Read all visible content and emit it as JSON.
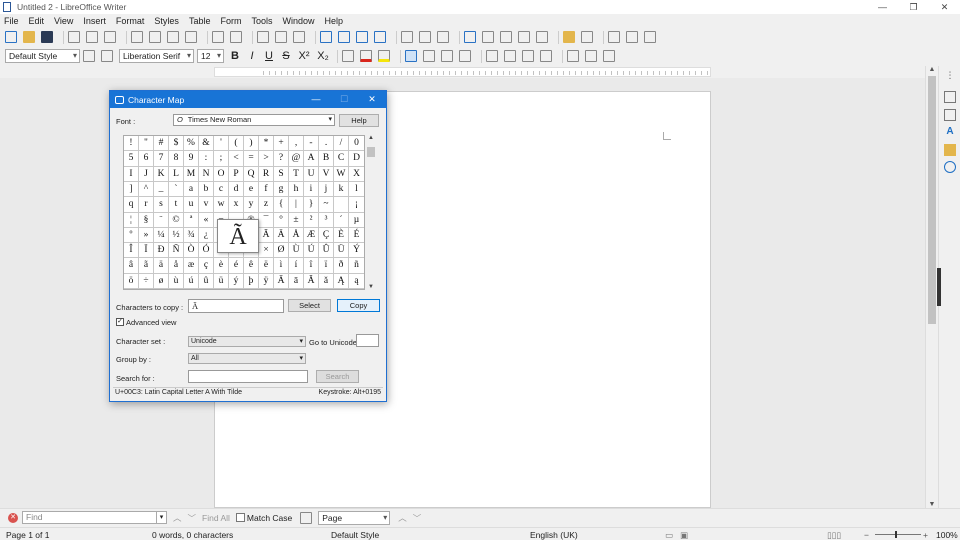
{
  "window": {
    "title": "Untitled 2 - LibreOffice Writer",
    "controls": [
      "—",
      "❐",
      "✕"
    ]
  },
  "menu": [
    "File",
    "Edit",
    "View",
    "Insert",
    "Format",
    "Styles",
    "Table",
    "Form",
    "Tools",
    "Window",
    "Help"
  ],
  "formatting": {
    "paragraph_style": "Default Style",
    "font_name": "Liberation Serif",
    "font_size": "12",
    "bold": "B",
    "italic": "I",
    "underline": "U",
    "strike": "S",
    "superscript": "X²",
    "subscript": "X₂"
  },
  "dialog": {
    "title": "Character Map",
    "font_label": "Font :",
    "font_value": "Times New Roman",
    "help_button": "Help",
    "characters_label": [
      [
        "!",
        "\"",
        "#",
        "$",
        "%",
        "&",
        "'",
        "(",
        ")",
        "*",
        "+",
        ",",
        "-",
        ".",
        "/",
        "0",
        "1",
        "2",
        "3",
        "4"
      ],
      [
        "5",
        "6",
        "7",
        "8",
        "9",
        ":",
        ";",
        "<",
        "=",
        ">",
        "?",
        "@",
        "A",
        "B",
        "C",
        "D",
        "E",
        "F",
        "G",
        "H"
      ],
      [
        "I",
        "J",
        "K",
        "L",
        "M",
        "N",
        "O",
        "P",
        "Q",
        "R",
        "S",
        "T",
        "U",
        "V",
        "W",
        "X",
        "Y",
        "Z",
        "[",
        "\\"
      ],
      [
        "]",
        "^",
        "_",
        "`",
        "a",
        "b",
        "c",
        "d",
        "e",
        "f",
        "g",
        "h",
        "i",
        "j",
        "k",
        "l",
        "m",
        "n",
        "o",
        "p"
      ],
      [
        "q",
        "r",
        "s",
        "t",
        "u",
        "v",
        "w",
        "x",
        "y",
        "z",
        "{",
        "|",
        "}",
        "~",
        "",
        "¡",
        "¢",
        "£",
        "¤",
        "¥"
      ],
      [
        "¦",
        "§",
        "¨",
        "©",
        "ª",
        "«",
        "¬",
        "",
        "®",
        "¯",
        "°",
        "±",
        "²",
        "³",
        "´",
        "µ",
        "¶",
        "·",
        "¸",
        "¹"
      ],
      [
        "º",
        "»",
        "¼",
        "½",
        "¾",
        "¿",
        "À",
        "Á",
        "Â",
        "Ã",
        "Ä",
        "Å",
        "Æ",
        "Ç",
        "È",
        "É",
        "Ê",
        "Ë",
        "Ì",
        "Í"
      ],
      [
        "Î",
        "Ï",
        "Ð",
        "Ñ",
        "Ò",
        "Ó",
        "Ô",
        "Õ",
        "Ö",
        "×",
        "Ø",
        "Ù",
        "Ú",
        "Û",
        "Ü",
        "Ý",
        "Þ",
        "ß",
        "à",
        "á"
      ],
      [
        "â",
        "ã",
        "ä",
        "å",
        "æ",
        "ç",
        "è",
        "é",
        "ê",
        "ë",
        "ì",
        "í",
        "î",
        "ï",
        "ð",
        "ñ",
        "ò",
        "ó",
        "ô",
        "õ"
      ],
      [
        "ö",
        "÷",
        "ø",
        "ù",
        "ú",
        "û",
        "ü",
        "ý",
        "þ",
        "ÿ",
        "Ā",
        "ā",
        "Ă",
        "ă",
        "Ą",
        "ą",
        "Ć",
        "ć",
        "Ĉ",
        "ĉ"
      ]
    ],
    "grid_rows": [
      [
        "!",
        "\"",
        "#",
        "$",
        "%",
        "&",
        "'",
        "(",
        ")",
        "*",
        "+",
        ",",
        "-",
        ".",
        "/",
        "0",
        "1",
        "2",
        "3",
        "4"
      ],
      [
        "5",
        "6",
        "7",
        "8",
        "9",
        ":",
        ";",
        "<",
        "=",
        ">",
        "?",
        "@",
        "A",
        "B",
        "C",
        "D",
        "E",
        "F",
        "G",
        "H"
      ]
    ],
    "grid": [
      "!",
      "\"",
      "#",
      "$",
      "%",
      "&",
      "'",
      "(",
      ")",
      "*",
      "+",
      ",",
      "-",
      ".",
      "/",
      "0",
      "5",
      "6",
      "7",
      "8",
      "9",
      ":",
      ";",
      "<",
      "=",
      ">",
      "?",
      "@",
      "A",
      "B",
      "C",
      "D",
      "I",
      "J",
      "K",
      "L",
      "M",
      "N",
      "O",
      "P",
      "Q",
      "R",
      "S",
      "T",
      "U",
      "V",
      "W",
      "X",
      "]",
      "^",
      "_",
      "`",
      "a",
      "b",
      "c",
      "d",
      "e",
      "f",
      "g",
      "h",
      "i",
      "j",
      "k",
      "l",
      "q",
      "r",
      "s",
      "t",
      "u",
      "v",
      "w",
      "x",
      "y",
      "z",
      "{",
      "|",
      "}",
      "~",
      "",
      "¡",
      "¦",
      "§",
      "¨",
      "©",
      "ª",
      "«",
      "¬",
      "",
      "®",
      "¯",
      "°",
      "±",
      "²",
      "³",
      "´",
      "µ",
      "º",
      "»",
      "¼",
      "½",
      "¾",
      "¿",
      "À",
      "Á",
      "Â",
      "Ã",
      "Ä",
      "Å",
      "Æ",
      "Ç",
      "È",
      "É",
      "Î",
      "Ï",
      "Ð",
      "Ñ",
      "Ò",
      "Ó",
      "Ô",
      "Õ",
      "Ö",
      "×",
      "Ø",
      "Ù",
      "Ú",
      "Û",
      "Ü",
      "Ý",
      "â",
      "ã",
      "ä",
      "å",
      "æ",
      "ç",
      "è",
      "é",
      "ê",
      "ë",
      "ì",
      "í",
      "î",
      "ï",
      "ð",
      "ñ",
      "ö",
      "÷",
      "ø",
      "ù",
      "ú",
      "û",
      "ü",
      "ý",
      "þ",
      "ÿ",
      "Ā",
      "ā",
      "Ă",
      "ă",
      "Ą",
      "ą"
    ],
    "preview_char": "Ã",
    "chars_to_copy_label": "Characters to copy :",
    "chars_to_copy_value": "Ã",
    "select_button": "Select",
    "copy_button": "Copy",
    "advanced_view_label": "Advanced view",
    "advanced_view_checked": true,
    "character_set_label": "Character set :",
    "character_set_value": "Unicode",
    "go_to_unicode_label": "Go to Unicode :",
    "go_to_unicode_value": "",
    "group_by_label": "Group by :",
    "group_by_value": "All",
    "search_for_label": "Search for :",
    "search_for_value": "",
    "search_button": "Search",
    "status_left": "U+00C3: Latin Capital Letter A With Tilde",
    "status_right": "Keystroke: Alt+0195"
  },
  "findbar": {
    "placeholder": "Find",
    "find_all": "Find All",
    "match_case": "Match Case",
    "search_type": "Page"
  },
  "statusbar": {
    "page": "Page 1 of 1",
    "words": "0 words, 0 characters",
    "style": "Default Style",
    "language": "English (UK)",
    "zoom": "100%"
  }
}
